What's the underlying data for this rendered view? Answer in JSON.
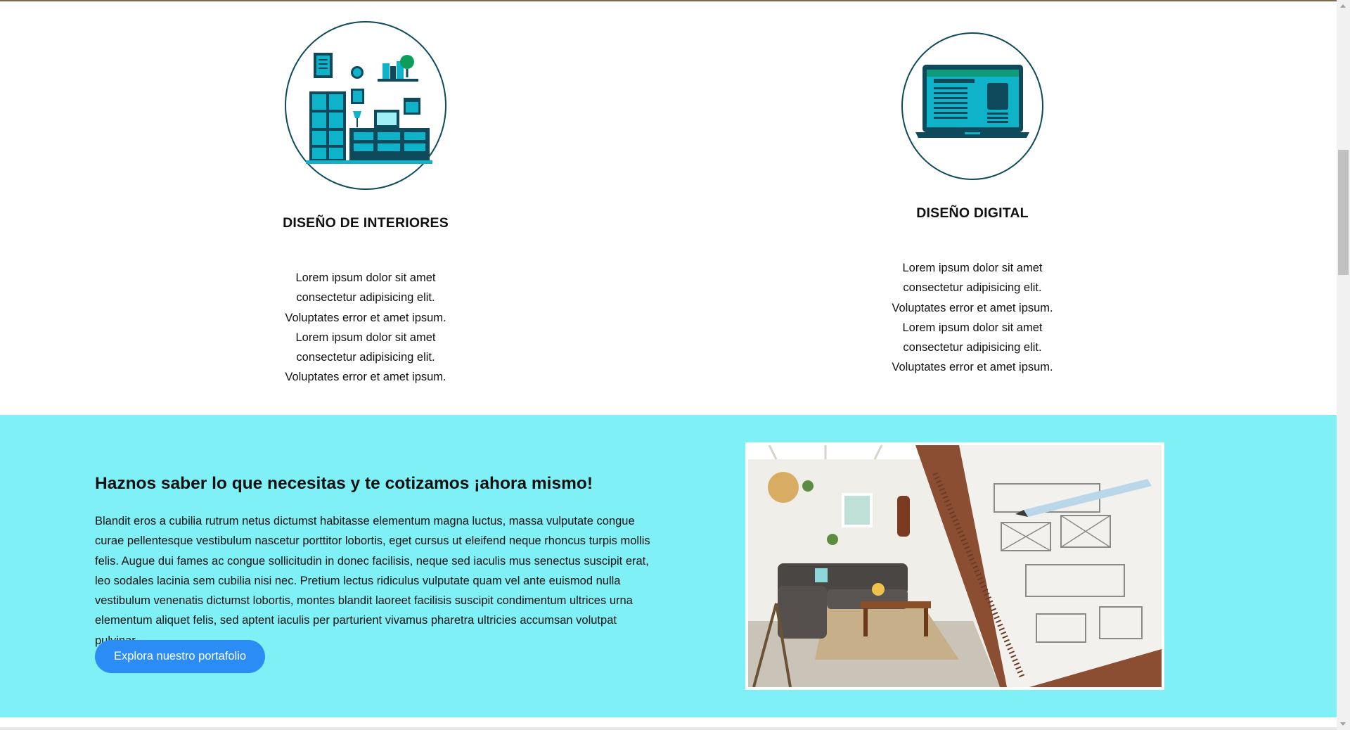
{
  "services": [
    {
      "title": "DISEÑO DE INTERIORES",
      "description": "Lorem ipsum dolor sit amet consectetur adipisicing elit. Voluptates error et amet ipsum. Lorem ipsum dolor sit amet consectetur adipisicing elit. Voluptates error et amet ipsum.",
      "icon": "interior-design-icon"
    },
    {
      "title": "DISEÑO DIGITAL",
      "description": "Lorem ipsum dolor sit amet consectetur adipisicing elit. Voluptates error et amet ipsum. Lorem ipsum dolor sit amet consectetur adipisicing elit. Voluptates error et amet ipsum.",
      "icon": "laptop-icon"
    }
  ],
  "cta": {
    "heading": "Haznos saber lo que necesitas y te cotizamos ¡ahora mismo!",
    "body": "Blandit eros a cubilia rutrum netus dictumst habitasse elementum magna luctus, massa vulputate congue curae pellentesque vestibulum nascetur porttitor lobortis, eget cursus ut eleifend neque rhoncus turpis mollis felis. Augue dui fames ac congue sollicitudin in donec facilisis, neque sed iaculis mus senectus suscipit erat, leo sodales lacinia sem cubilia nisi nec. Pretium lectus ridiculus vulputate quam vel ante euismod nulla vestibulum venenatis dictumst lobortis, montes blandit laoreet facilisis suscipit condimentum ultrices urna elementum aliquet felis, sed aptent iaculis per parturient vivamus pharetra ultricies accumsan volutpat pulvinar.",
    "button_label": "Explora nuestro portafolio",
    "image": "living-room-and-sketch-notebook-photo"
  },
  "colors": {
    "accent": "#2a8cf4",
    "band": "#7ff0f6",
    "circle_border": "#0e4a5c",
    "icon_teal": "#0fb3c9",
    "icon_dark": "#0e4a5c"
  }
}
